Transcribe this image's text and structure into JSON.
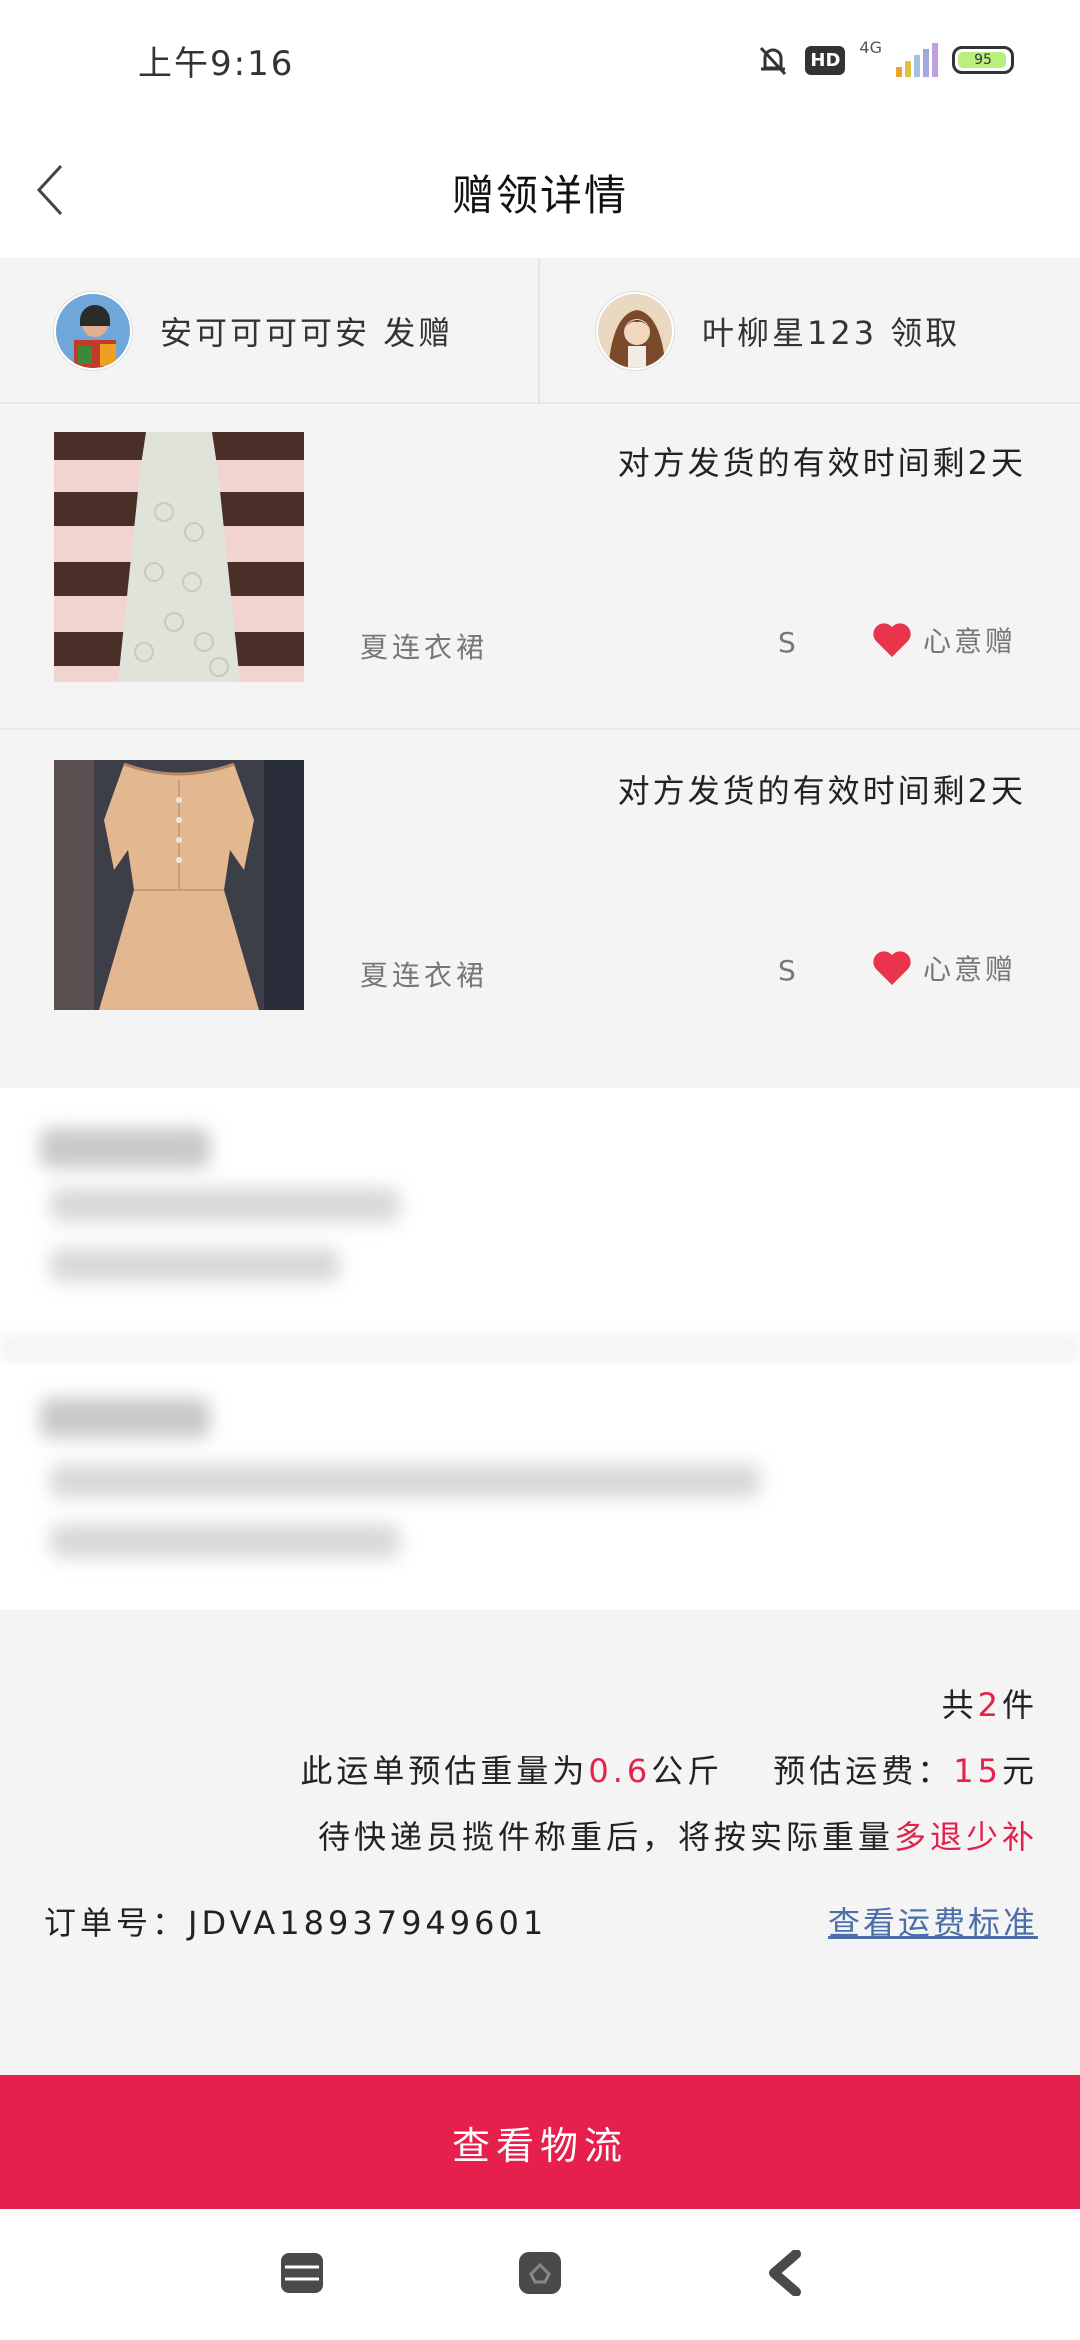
{
  "status_bar": {
    "time": "上午9:16",
    "network": "4G",
    "hd": "HD",
    "battery": "95",
    "battery_level": 0.95
  },
  "header": {
    "title": "赠领详情"
  },
  "users": {
    "giver": {
      "name": "安可可可可安",
      "action": "发赠"
    },
    "receiver": {
      "name": "叶柳星123",
      "action": "领取"
    }
  },
  "items": [
    {
      "deadline": "对方发货的有效时间剩2天",
      "name": "夏连衣裙",
      "size": "S",
      "gift_type": "心意赠"
    },
    {
      "deadline": "对方发货的有效时间剩2天",
      "name": "夏连衣裙",
      "size": "S",
      "gift_type": "心意赠"
    }
  ],
  "summary": {
    "count_prefix": "共",
    "count": "2",
    "count_suffix": "件",
    "weight_prefix": "此运单预估重量为",
    "weight": "0.6",
    "weight_unit": "公斤",
    "fee_prefix": "预估运费：",
    "fee": "15",
    "fee_unit": "元",
    "note_prefix": "待快递员揽件称重后，将按实际重量",
    "note_highlight": "多退少补",
    "order_label": "订单号：",
    "order_number": "JDVA18937949601",
    "fee_link": "查看运费标准"
  },
  "actions": {
    "logistics": "查看物流"
  },
  "colors": {
    "accent": "#e61f4d",
    "highlight": "#e3224c",
    "link": "#4b6fa8",
    "heart": "#e8334a"
  },
  "nav": {
    "icons": [
      "menu-icon",
      "home-icon",
      "back-icon"
    ]
  }
}
